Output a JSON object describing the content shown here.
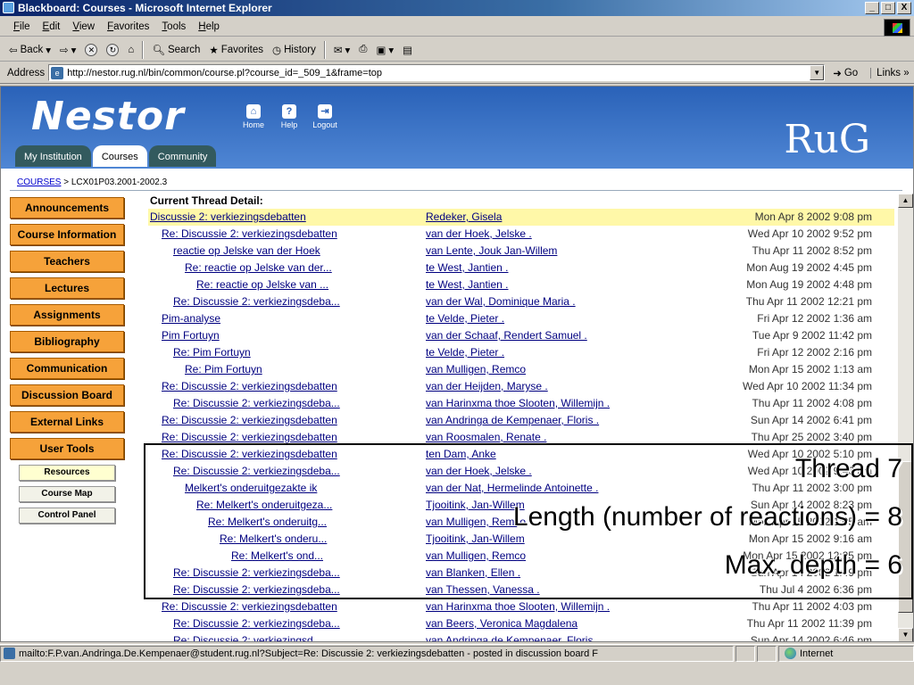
{
  "window": {
    "title": "Blackboard: Courses - Microsoft Internet Explorer",
    "controls": [
      "_",
      "□",
      "X"
    ]
  },
  "menubar": [
    "File",
    "Edit",
    "View",
    "Favorites",
    "Tools",
    "Help"
  ],
  "toolbar": {
    "back": "Back",
    "search": "Search",
    "favorites": "Favorites",
    "history": "History"
  },
  "address": {
    "label": "Address",
    "url": "http://nestor.rug.nl/bin/common/course.pl?course_id=_509_1&frame=top",
    "go": "Go",
    "links": "Links"
  },
  "banner": {
    "logo": "Nestor",
    "icons": [
      "Home",
      "Help",
      "Logout"
    ],
    "rug": "RuG",
    "tabs": [
      "My Institution",
      "Courses",
      "Community"
    ],
    "active_tab": "Courses"
  },
  "breadcrumb": {
    "link": "COURSES",
    "current": "LCX01P03.2001-2002.3"
  },
  "leftnav": {
    "buttons": [
      "Announcements",
      "Course Information",
      "Teachers",
      "Lectures",
      "Assignments",
      "Bibliography",
      "Communication",
      "Discussion Board",
      "External Links",
      "User Tools"
    ],
    "tools": [
      "Resources",
      "Course Map",
      "Control Panel"
    ]
  },
  "thread": {
    "header": "Current Thread Detail:",
    "rows": [
      {
        "subject": "Discussie 2: verkiezingsdebatten",
        "author": "Redeker, Gisela",
        "date": "Mon Apr 8 2002 9:08 pm",
        "depth": 0,
        "highlight": true
      },
      {
        "subject": "Re: Discussie 2: verkiezingsdebatten",
        "author": "van der Hoek, Jelske .",
        "date": "Wed Apr 10 2002 9:52 pm",
        "depth": 1
      },
      {
        "subject": "reactie op Jelske van der Hoek",
        "author": "van Lente, Jouk Jan-Willem",
        "date": "Thu Apr 11 2002 8:52 pm",
        "depth": 2
      },
      {
        "subject": "Re: reactie op Jelske van der...",
        "author": "te West, Jantien .",
        "date": "Mon Aug 19 2002 4:45 pm",
        "depth": 3
      },
      {
        "subject": "Re: reactie op Jelske van ...",
        "author": "te West, Jantien .",
        "date": "Mon Aug 19 2002 4:48 pm",
        "depth": 4
      },
      {
        "subject": "Re: Discussie 2: verkiezingsdeba...",
        "author": "van der Wal, Dominique Maria .",
        "date": "Thu Apr 11 2002 12:21 pm",
        "depth": 2
      },
      {
        "subject": "Pim-analyse",
        "author": "te Velde, Pieter .",
        "date": "Fri Apr 12 2002 1:36 am",
        "depth": 1
      },
      {
        "subject": "Pim Fortuyn",
        "author": "van der Schaaf, Rendert Samuel .",
        "date": "Tue Apr 9 2002 11:42 pm",
        "depth": 1
      },
      {
        "subject": "Re: Pim Fortuyn",
        "author": "te Velde, Pieter .",
        "date": "Fri Apr 12 2002 2:16 pm",
        "depth": 2
      },
      {
        "subject": "Re: Pim Fortuyn",
        "author": "van Mulligen, Remco",
        "date": "Mon Apr 15 2002 1:13 am",
        "depth": 3
      },
      {
        "subject": "Re: Discussie 2: verkiezingsdebatten",
        "author": "van der Heijden, Maryse .",
        "date": "Wed Apr 10 2002 11:34 pm",
        "depth": 1
      },
      {
        "subject": "Re: Discussie 2: verkiezingsdeba...",
        "author": "van Harinxma thoe Slooten, Willemijn .",
        "date": "Thu Apr 11 2002 4:08 pm",
        "depth": 2
      },
      {
        "subject": "Re: Discussie 2: verkiezingsdebatten",
        "author": "van Andringa de Kempenaer, Floris .",
        "date": "Sun Apr 14 2002 6:41 pm",
        "depth": 1
      },
      {
        "subject": "Re: Discussie 2: verkiezingsdebatten",
        "author": "van Roosmalen, Renate .",
        "date": "Thu Apr 25 2002 3:40 pm",
        "depth": 1
      },
      {
        "subject": "Re: Discussie 2: verkiezingsdebatten",
        "author": "ten Dam, Anke",
        "date": "Wed Apr 10 2002 5:10 pm",
        "depth": 1
      },
      {
        "subject": "Re: Discussie 2: verkiezingsdeba...",
        "author": "van der Hoek, Jelske .",
        "date": "Wed Apr 10 2002 9:46 pm",
        "depth": 2
      },
      {
        "subject": "Melkert's onderuitgezakte ik",
        "author": "van der Nat, Hermelinde Antoinette .",
        "date": "Thu Apr 11 2002 3:00 pm",
        "depth": 3
      },
      {
        "subject": "Re: Melkert's onderuitgeza...",
        "author": "Tjooitink, Jan-Willem",
        "date": "Sun Apr 14 2002 8:23 pm",
        "depth": 4
      },
      {
        "subject": "Re: Melkert's onderuitg...",
        "author": "van Mulligen, Remco",
        "date": "Mon Apr 15 2002 1:05 am",
        "depth": 5
      },
      {
        "subject": "Re: Melkert's onderu...",
        "author": "Tjooitink, Jan-Willem",
        "date": "Mon Apr 15 2002 9:16 am",
        "depth": 6
      },
      {
        "subject": "Re: Melkert's ond...",
        "author": "van Mulligen, Remco",
        "date": "Mon Apr 15 2002 12:25 pm",
        "depth": 7
      },
      {
        "subject": "Re: Discussie 2: verkiezingsdeba...",
        "author": "van Blanken, Ellen .",
        "date": "Sun Apr 14 2002 1:49 pm",
        "depth": 2
      },
      {
        "subject": "Re: Discussie 2: verkiezingsdeba...",
        "author": "van Thessen, Vanessa .",
        "date": "Thu Jul 4 2002 6:36 pm",
        "depth": 2
      },
      {
        "subject": "Re: Discussie 2: verkiezingsdebatten",
        "author": "van Harinxma thoe Slooten, Willemijn .",
        "date": "Thu Apr 11 2002 4:03 pm",
        "depth": 1
      },
      {
        "subject": "Re: Discussie 2: verkiezingsdeba...",
        "author": "van Beers, Veronica Magdalena",
        "date": "Thu Apr 11 2002 11:39 pm",
        "depth": 2
      },
      {
        "subject": "Re: Discussie 2: verkiezingsd...",
        "author": "van Andringa de Kempenaer, Floris .",
        "date": "Sun Apr 14 2002 6:46 pm",
        "depth": 2
      }
    ]
  },
  "overlay": {
    "line1": "Thread 7",
    "line2": "Length (number of reactions) = 8",
    "line3": "Max. depth = 6"
  },
  "status": {
    "text": "mailto:F.P.van.Andringa.De.Kempenaer@student.rug.nl?Subject=Re: Discussie 2: verkiezingsdebatten - posted in discussion board F",
    "zone": "Internet"
  }
}
